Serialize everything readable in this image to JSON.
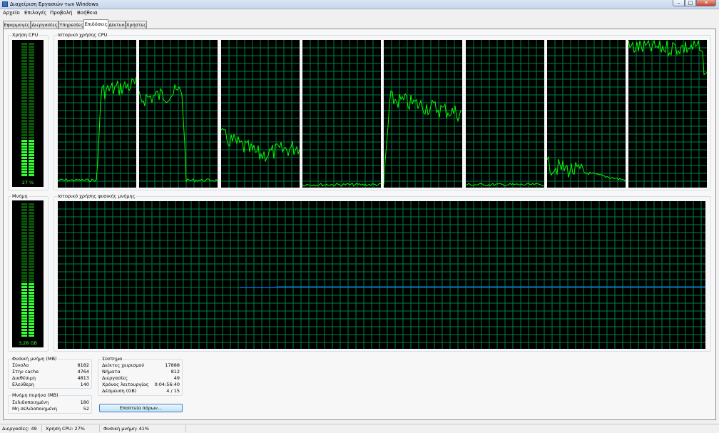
{
  "window": {
    "title": "Διαχείριση Εργασιών των Windows"
  },
  "menu": [
    "Αρχείο",
    "Επιλογές",
    "Προβολή",
    "Βοήθεια"
  ],
  "tabs": [
    "Εφαρμογές",
    "Διεργασίες",
    "Υπηρεσίες",
    "Επιδόσεις",
    "Δίκτυο",
    "Χρήστες"
  ],
  "active_tab": "Επιδόσεις",
  "cpu": {
    "usage_label": "Χρήση CPU",
    "usage_value": "27 %",
    "usage_fraction": 0.27,
    "history_label": "Ιστορικό χρήσης CPU",
    "cores": 8
  },
  "memory": {
    "usage_label": "Μνήμη",
    "usage_value": "3,28 GB",
    "usage_fraction": 0.41,
    "history_label": "Ιστορικό χρήσης φυσικής μνήμης"
  },
  "physical_memory": {
    "label": "Φυσική μνήμη (MB)",
    "rows": [
      {
        "k": "Σύνολο",
        "v": "8182"
      },
      {
        "k": "Στην cache",
        "v": "4764"
      },
      {
        "k": "Διαθέσιμη",
        "v": "4813"
      },
      {
        "k": "Ελεύθερη",
        "v": "140"
      }
    ]
  },
  "kernel_memory": {
    "label": "Μνήμη πυρήνα (MB)",
    "rows": [
      {
        "k": "Σελιδοποιημένη",
        "v": "180"
      },
      {
        "k": "Μη σελιδοποιημένη",
        "v": "52"
      }
    ]
  },
  "system": {
    "label": "Σύστημα",
    "rows": [
      {
        "k": "Δείκτες χειρισμού",
        "v": "17888"
      },
      {
        "k": "Νήματα",
        "v": "812"
      },
      {
        "k": "Διεργασίες",
        "v": "49"
      },
      {
        "k": "Χρόνος λειτουργίας",
        "v": "0:04:56:40"
      },
      {
        "k": "Δέσμευση (GB)",
        "v": "4 / 15"
      }
    ]
  },
  "resource_monitor_button": "Εποπτεία πόρων...",
  "statusbar": {
    "processes": "Διεργασίες: 49",
    "cpu": "Χρήση CPU: 27%",
    "memory": "Φυσική μνήμη: 41%"
  },
  "colors": {
    "graph_bg": "#000000",
    "grid": "#008040",
    "cpu_line": "#00ff00",
    "mem_line": "#0080ff",
    "gauge_on": "#33ff33",
    "gauge_off": "#0a5a0a"
  }
}
